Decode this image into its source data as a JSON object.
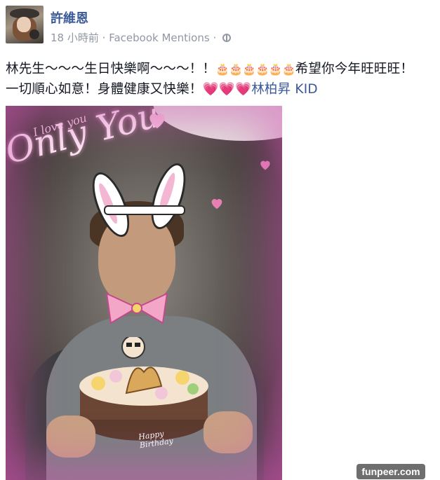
{
  "post": {
    "author": "許維恩",
    "timestamp": "18 小時前",
    "separator": "·",
    "source": "Facebook Mentions",
    "separator2": "·",
    "privacy_icon": "globe-icon",
    "message": {
      "part1": "林先生〜〜〜生日快樂啊〜〜〜！！",
      "cake_emojis": "🎂🎂🎂🎂🎂🎂",
      "part2": "希望你今年旺旺旺！",
      "line2": "一切順心如意！身體健康又快樂！",
      "hearts": "💗💗💗",
      "tag": "林柏昇 KID"
    },
    "photo": {
      "overlay_text_main": "Only You",
      "overlay_text_small": "I love you",
      "cake_text_line1": "Happy",
      "cake_text_line2": "Birthday"
    }
  },
  "watermark": "funpeer.com",
  "colors": {
    "link": "#3b5998",
    "meta": "#9197a3",
    "text": "#141823",
    "frame_pink": "#d25ab4"
  }
}
